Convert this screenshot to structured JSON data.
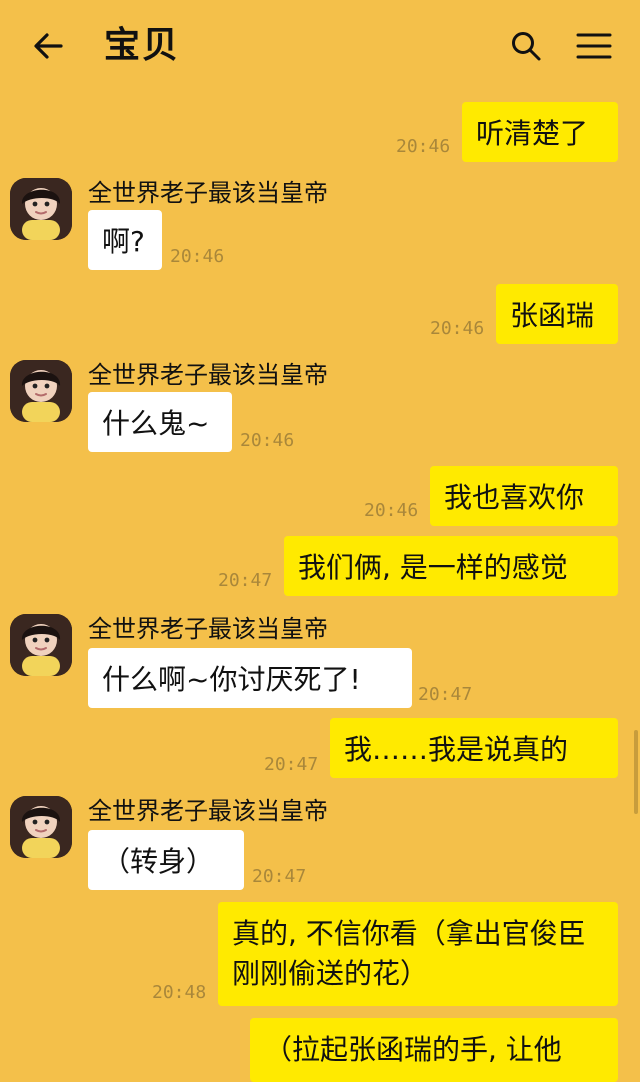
{
  "header": {
    "title": "宝贝"
  },
  "timestamps": {
    "t1": "20:46",
    "t2": "20:46",
    "t3": "20:46",
    "t4": "20:46",
    "t5": "20:46",
    "t6": "20:47",
    "t7": "20:47",
    "t8": "20:47",
    "t9": "20:47",
    "t10": "20:48"
  },
  "sender_name": "全世界老子最该当皇帝",
  "messages": {
    "m1": "听清楚了",
    "m2": "啊?",
    "m3": "张函瑞",
    "m4": "什么鬼~",
    "m5": "我也喜欢你",
    "m6": "我们俩, 是一样的感觉",
    "m7": "什么啊~你讨厌死了!",
    "m8": "我……我是说真的",
    "m9": "（转身）",
    "m10": "真的, 不信你看（拿出官俊臣刚刚偷送的花）",
    "m11": "（拉起张函瑞的手, 让他"
  },
  "icons": {
    "back": "back-arrow-icon",
    "search": "search-icon",
    "menu": "menu-icon",
    "avatar": "avatar-image"
  },
  "colors": {
    "background": "#F4C04A",
    "sent_bubble": "#FFEA00",
    "received_bubble": "#FFFFFF"
  }
}
